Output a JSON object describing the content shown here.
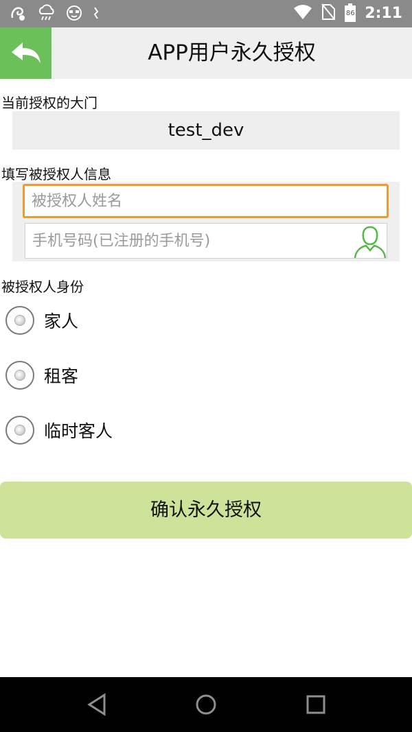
{
  "status_bar": {
    "time": "2:11",
    "battery_level": "86",
    "icons": [
      "uc-browser-icon",
      "cloud-rain-icon",
      "face-icon",
      "loading-icon",
      "wifi-icon",
      "no-sim-icon",
      "battery-icon"
    ]
  },
  "header": {
    "title": "APP用户永久授权",
    "back_icon": "back-arrow-icon"
  },
  "gate": {
    "label": "当前授权的大门",
    "value": "test_dev"
  },
  "grantee_info": {
    "label": "填写被授权人信息",
    "name_placeholder": "被授权人姓名",
    "phone_placeholder": "手机号码(已注册的手机号)",
    "contact_icon": "contact-person-icon"
  },
  "identity": {
    "label": "被授权人身份",
    "options": [
      "家人",
      "租客",
      "临时客人"
    ]
  },
  "confirm_button": "确认永久授权",
  "colors": {
    "accent_green": "#6cc05a",
    "focus_orange": "#f19a2b",
    "button_green": "#cde39a",
    "status_gray": "#8a8a8a"
  },
  "nav_bar": [
    "back-triangle-icon",
    "home-circle-icon",
    "recents-square-icon"
  ]
}
